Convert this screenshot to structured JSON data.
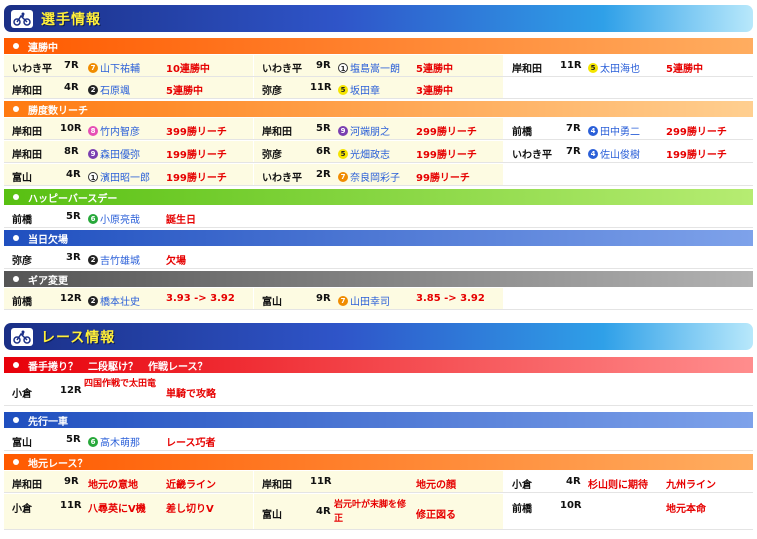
{
  "sections": {
    "players": "選手情報",
    "race": "レース情報"
  },
  "categories": {
    "streak": "連勝中",
    "reach": "勝度数リーチ",
    "birthday": "ハッピーバースデー",
    "absent": "当日欠場",
    "gear": "ギア変更",
    "question": "番手捲り？　二段駆け？　作戦レース？",
    "lead": "先行一車",
    "local": "地元レース？"
  },
  "streak": [
    {
      "venue": "いわき平",
      "race": "7R",
      "num": "7",
      "player": "山下祐輔",
      "note": "10連勝中"
    },
    {
      "venue": "いわき平",
      "race": "9R",
      "num": "1",
      "player": "塩島嵩一朗",
      "note": "5連勝中"
    },
    {
      "venue": "岸和田",
      "race": "11R",
      "num": "5",
      "player": "太田海也",
      "note": "5連勝中"
    },
    {
      "venue": "岸和田",
      "race": "4R",
      "num": "2",
      "player": "石原颯",
      "note": "5連勝中"
    },
    {
      "venue": "弥彦",
      "race": "11R",
      "num": "5",
      "player": "坂田章",
      "note": "3連勝中"
    }
  ],
  "reach": [
    {
      "venue": "岸和田",
      "race": "10R",
      "num": "8",
      "player": "竹内智彦",
      "note": "399勝リーチ"
    },
    {
      "venue": "岸和田",
      "race": "5R",
      "num": "9",
      "player": "河端朋之",
      "note": "299勝リーチ"
    },
    {
      "venue": "前橋",
      "race": "7R",
      "num": "4",
      "player": "田中勇二",
      "note": "299勝リーチ"
    },
    {
      "venue": "岸和田",
      "race": "8R",
      "num": "9",
      "player": "森田優弥",
      "note": "199勝リーチ"
    },
    {
      "venue": "弥彦",
      "race": "6R",
      "num": "5",
      "player": "光畑政志",
      "note": "199勝リーチ"
    },
    {
      "venue": "いわき平",
      "race": "7R",
      "num": "4",
      "player": "佐山俊樹",
      "note": "199勝リーチ"
    },
    {
      "venue": "富山",
      "race": "4R",
      "num": "1",
      "player": "濱田昭一郎",
      "note": "199勝リーチ"
    },
    {
      "venue": "いわき平",
      "race": "2R",
      "num": "7",
      "player": "奈良岡彩子",
      "note": "99勝リーチ"
    }
  ],
  "birthday": [
    {
      "venue": "前橋",
      "race": "5R",
      "num": "6",
      "player": "小原亮哉",
      "note": "誕生日"
    }
  ],
  "absent": [
    {
      "venue": "弥彦",
      "race": "3R",
      "num": "2",
      "player": "吉竹雄城",
      "note": "欠場"
    }
  ],
  "gear": [
    {
      "venue": "前橋",
      "race": "12R",
      "num": "2",
      "player": "橋本壮史",
      "note": "3.93 -> 3.92"
    },
    {
      "venue": "富山",
      "race": "9R",
      "num": "7",
      "player": "山田幸司",
      "note": "3.85 -> 3.92"
    }
  ],
  "question": [
    {
      "venue": "小倉",
      "race": "12R",
      "desc": "四国作戦で太田竜",
      "note": "単騎で攻略"
    }
  ],
  "lead": [
    {
      "venue": "富山",
      "race": "5R",
      "num": "6",
      "player": "高木萌那",
      "note": "レース巧者"
    }
  ],
  "local": [
    {
      "venue": "岸和田",
      "race": "9R",
      "desc": "地元の意地",
      "note": "近畿ライン"
    },
    {
      "venue": "岸和田",
      "race": "11R",
      "desc": "",
      "note": "地元の顔"
    },
    {
      "venue": "小倉",
      "race": "4R",
      "desc": "杉山则に期待",
      "note": "九州ライン"
    },
    {
      "venue": "小倉",
      "race": "11R",
      "desc": "八尋英にV機",
      "note": "差し切りV"
    },
    {
      "venue": "富山",
      "race": "4R",
      "desc": "岩元叶が末脚を修正",
      "note": "修正図る"
    },
    {
      "venue": "前橋",
      "race": "10R",
      "desc": "",
      "note": "地元本命"
    }
  ],
  "colors": {
    "1": "#ffffff",
    "2": "#222222",
    "4": "#2a5fd8",
    "5": "#f4e400",
    "6": "#27a83a",
    "7": "#f08c00",
    "8": "#e64fb4",
    "9": "#7a3fb0"
  }
}
